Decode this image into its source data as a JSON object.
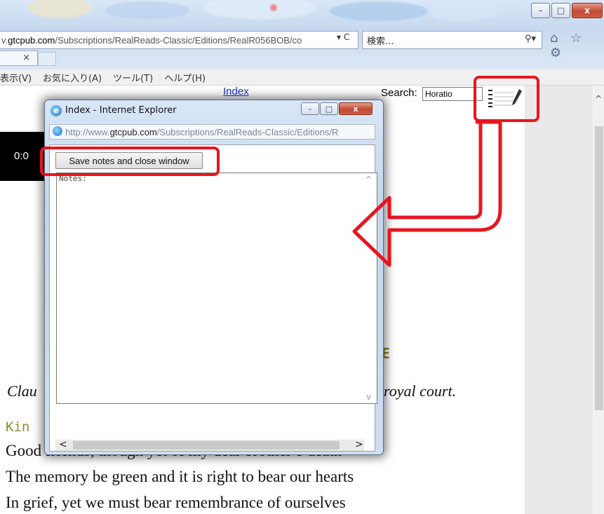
{
  "browser": {
    "address_url_prefix": "v.",
    "address_url_host": "gtcpub.com",
    "address_url_path": "/Subscriptions/RealReads-Classic/Editions/RealR056BOB/co",
    "address_tools": "▾ C",
    "search_placeholder": "検索...",
    "search_icon": "magnifier-icon",
    "toolbar_icons": "⌂ ☆ ⚙",
    "tab_close": "×",
    "window_controls": {
      "minimize": "–",
      "maximize": "□",
      "close": "x"
    },
    "menu": [
      "表示(V)",
      "お気に入り(A)",
      "ツール(T)",
      "ヘルプ(H)"
    ]
  },
  "page": {
    "index_link": "Index",
    "search_label": "Search:",
    "search_value": "Horatio",
    "video_time": "0:0",
    "olive_letter": "E",
    "clau_text": "Clau",
    "court_text": "royal court.",
    "kin_text": "Kin",
    "lines": [
      "Good friends, though yet of my dear brother’s death",
      "The memory be green and it is right to bear our hearts",
      "In grief, yet we must bear remembrance of ourselves"
    ],
    "scroll_up": "^"
  },
  "popup": {
    "title": "Index - Internet Explorer",
    "url_prefix": "http://www.",
    "url_host": "gtcpub.com",
    "url_path": "/Subscriptions/RealReads-Classic/Editions/R",
    "save_button": "Save notes and close window",
    "notes_text": "Notes:",
    "controls": {
      "minimize": "–",
      "maximize": "□",
      "close": "x"
    },
    "scroll_up": "^",
    "scroll_down": "v",
    "hscroll_left": "<",
    "hscroll_right": ">"
  },
  "colors": {
    "highlight": "#e8141e",
    "link": "#1a33d4",
    "olive": "#8a8a2a"
  }
}
